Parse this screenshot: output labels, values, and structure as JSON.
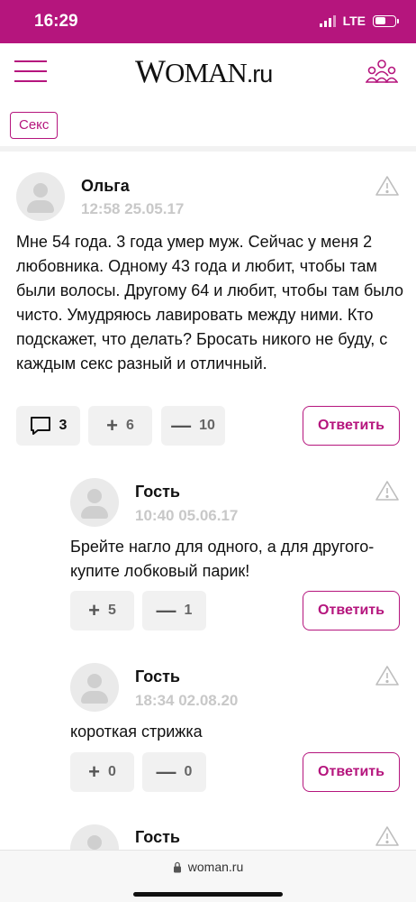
{
  "status_bar": {
    "time": "16:29",
    "network": "LTE",
    "battery_level": 0.55
  },
  "header": {
    "logo_w": "W",
    "logo_oman": "OMAN",
    "logo_ru": ".ru",
    "menu_icon": "hamburger-icon",
    "users_icon": "users-icon"
  },
  "tag": {
    "label": "Секс"
  },
  "comments": [
    {
      "author": "Ольга",
      "date": "12:58 25.05.17",
      "text": "Мне 54 года. 3 года умер муж. Сейчас у меня 2 любовника. Одному 43 года и любит, чтобы там были волосы. Другому 64 и любит, чтобы там было чисто. Умудряюсь лавировать между ними. Кто подскажет, что делать? Бросать никого не буду, с каждым секс разный и отличный.",
      "replies_count": "3",
      "likes": "6",
      "dislikes": "10",
      "reply_label": "Ответить"
    },
    {
      "author": "Гость",
      "date": "10:40 05.06.17",
      "text": "Брейте нагло для одного, а для другого- купите лобковый парик!",
      "likes": "5",
      "dislikes": "1",
      "reply_label": "Ответить"
    },
    {
      "author": "Гость",
      "date": "18:34 02.08.20",
      "text": "короткая стрижка",
      "likes": "0",
      "dislikes": "0",
      "reply_label": "Ответить"
    },
    {
      "author": "Гость"
    }
  ],
  "browser": {
    "url": "woman.ru",
    "lock_icon": "lock-icon"
  },
  "colors": {
    "accent": "#b5157d",
    "muted": "#c8c8c8",
    "pill_bg": "#f1f1f1"
  }
}
